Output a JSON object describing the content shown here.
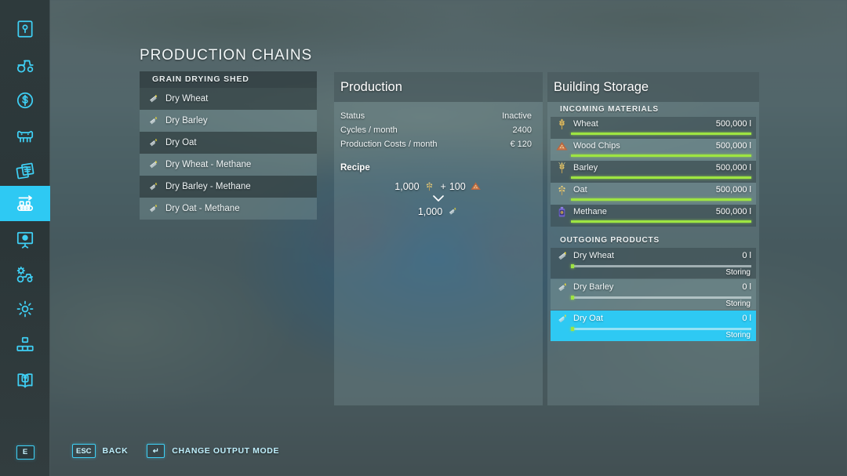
{
  "page_title": "PRODUCTION CHAINS",
  "sidebar": {
    "active_index": 5,
    "items": [
      {
        "icon": "map-marker-icon",
        "label": "map"
      },
      {
        "icon": "tractor-icon",
        "label": "vehicles"
      },
      {
        "icon": "dollar-coin-icon",
        "label": "finances"
      },
      {
        "icon": "cow-icon",
        "label": "animals"
      },
      {
        "icon": "contracts-icon",
        "label": "contracts"
      },
      {
        "icon": "production-chains-icon",
        "label": "production-chains"
      },
      {
        "icon": "statistics-board-icon",
        "label": "statistics"
      },
      {
        "icon": "vehicle-settings-icon",
        "label": "vehicle-settings"
      },
      {
        "icon": "gear-icon",
        "label": "game-settings"
      },
      {
        "icon": "multiplayer-icon",
        "label": "multiplayer"
      },
      {
        "icon": "help-book-icon",
        "label": "help"
      }
    ],
    "bottom_key": "E"
  },
  "chain_list": {
    "header": "GRAIN DRYING SHED",
    "items": [
      {
        "label": "Dry Wheat",
        "icon": "dry-wheat-icon"
      },
      {
        "label": "Dry Barley",
        "icon": "dry-barley-icon"
      },
      {
        "label": "Dry Oat",
        "icon": "dry-oat-icon"
      },
      {
        "label": "Dry Wheat - Methane",
        "icon": "dry-wheat-icon"
      },
      {
        "label": "Dry Barley - Methane",
        "icon": "dry-barley-icon"
      },
      {
        "label": "Dry Oat - Methane",
        "icon": "dry-oat-icon"
      }
    ]
  },
  "production": {
    "title": "Production",
    "stats": [
      {
        "label": "Status",
        "value": "Inactive"
      },
      {
        "label": "Cycles / month",
        "value": "2400"
      },
      {
        "label": "Production Costs / month",
        "value": "€ 120"
      }
    ],
    "recipe_title": "Recipe",
    "recipe": {
      "inputs": [
        {
          "amount": "1,000",
          "icon": "oat-icon"
        },
        {
          "plus": "+",
          "amount": "100",
          "icon": "wood-chips-icon"
        }
      ],
      "plus_sign": "+",
      "outputs": [
        {
          "amount": "1,000",
          "icon": "dry-oat-icon"
        }
      ]
    }
  },
  "storage": {
    "title": "Building Storage",
    "incoming_header": "INCOMING MATERIALS",
    "incoming": [
      {
        "name": "Wheat",
        "amount": "500,000 l",
        "fill_pct": 100,
        "icon": "wheat-icon"
      },
      {
        "name": "Wood Chips",
        "amount": "500,000 l",
        "fill_pct": 100,
        "icon": "wood-chips-icon"
      },
      {
        "name": "Barley",
        "amount": "500,000 l",
        "fill_pct": 100,
        "icon": "barley-icon"
      },
      {
        "name": "Oat",
        "amount": "500,000 l",
        "fill_pct": 100,
        "icon": "oat-icon"
      },
      {
        "name": "Methane",
        "amount": "500,000 l",
        "fill_pct": 100,
        "icon": "methane-icon"
      }
    ],
    "outgoing_header": "OUTGOING PRODUCTS",
    "outgoing": [
      {
        "name": "Dry Wheat",
        "amount": "0 l",
        "mode": "Storing",
        "fill_pct": 0,
        "icon": "dry-wheat-icon",
        "selected": false
      },
      {
        "name": "Dry Barley",
        "amount": "0 l",
        "mode": "Storing",
        "fill_pct": 0,
        "icon": "dry-barley-icon",
        "selected": false
      },
      {
        "name": "Dry Oat",
        "amount": "0 l",
        "mode": "Storing",
        "fill_pct": 0,
        "icon": "dry-oat-icon",
        "selected": true
      }
    ]
  },
  "helpbar": [
    {
      "key": "ESC",
      "label": "BACK"
    },
    {
      "key": "↵",
      "label": "CHANGE OUTPUT MODE"
    }
  ],
  "colors": {
    "accent_cyan": "#2ec9f3",
    "icon_cyan": "#3fd0f5",
    "bar_green": "#9ee542",
    "panel_bg": "rgba(126,152,156,0.30)"
  }
}
